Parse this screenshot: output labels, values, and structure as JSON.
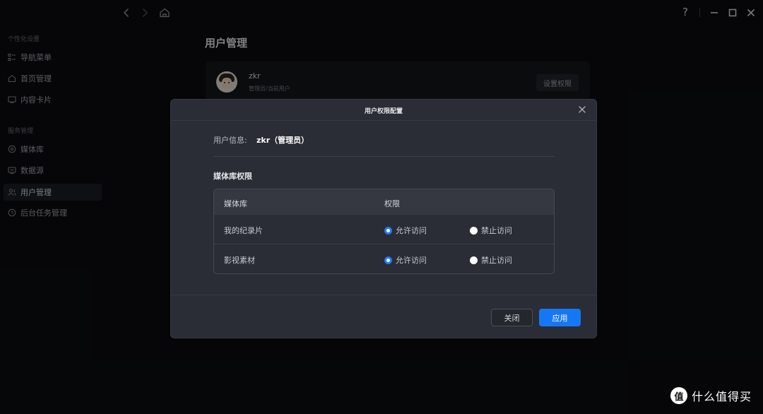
{
  "titlebar": {
    "help_label": "?"
  },
  "sidebar": {
    "sections": [
      {
        "title": "个性化设置",
        "items": [
          {
            "label": "导航菜单",
            "icon": "list-icon"
          },
          {
            "label": "首页管理",
            "icon": "home-icon"
          },
          {
            "label": "内容卡片",
            "icon": "monitor-icon"
          }
        ]
      },
      {
        "title": "服务管理",
        "items": [
          {
            "label": "媒体库",
            "icon": "media-icon"
          },
          {
            "label": "数据源",
            "icon": "datasource-icon"
          },
          {
            "label": "用户管理",
            "icon": "users-icon",
            "active": true
          },
          {
            "label": "后台任务管理",
            "icon": "clock-icon"
          }
        ]
      }
    ]
  },
  "main": {
    "page_title": "用户管理",
    "user_card": {
      "name": "zkr",
      "subtitle": "管理员/当前用户",
      "button_label": "设置权限"
    }
  },
  "modal": {
    "title": "用户权限配置",
    "user_info_label": "用户信息:",
    "user_info_value": "zkr（管理员）",
    "section_title": "媒体库权限",
    "table": {
      "headers": [
        "媒体库",
        "权限"
      ],
      "rows": [
        {
          "library": "我的纪录片",
          "allow_label": "允许访问",
          "deny_label": "禁止访问",
          "allowed": true
        },
        {
          "library": "影视素材",
          "allow_label": "允许访问",
          "deny_label": "禁止访问",
          "allowed": true
        }
      ]
    },
    "close_label": "关闭",
    "apply_label": "应用"
  },
  "watermark": {
    "logo": "值",
    "text": "什么值得买"
  },
  "colors": {
    "accent": "#1677f5",
    "background": "#0b0c0f",
    "modal": "#2a2d35"
  }
}
